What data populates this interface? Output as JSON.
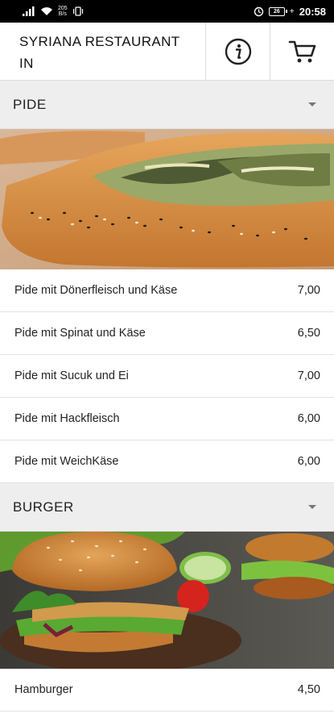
{
  "status_bar": {
    "network_top": "205",
    "network_bottom": "B/s",
    "battery_level": "26",
    "time": "20:58"
  },
  "header": {
    "title": "SYRIANA RESTAURANT IN",
    "info_icon": "info-icon",
    "cart_icon": "cart-icon"
  },
  "categories": [
    {
      "title": "PIDE",
      "image": "pide-photo",
      "items": [
        {
          "name": "Pide mit Dönerfleisch und Käse",
          "price": "7,00"
        },
        {
          "name": "Pide mit Spinat und Käse",
          "price": "6,50"
        },
        {
          "name": "Pide mit Sucuk und Ei",
          "price": "7,00"
        },
        {
          "name": "Pide mit Hackfleisch",
          "price": "6,00"
        },
        {
          "name": "Pide mit WeichKäse",
          "price": "6,00"
        }
      ]
    },
    {
      "title": "BURGER",
      "image": "burger-photo",
      "items": [
        {
          "name": "Hamburger",
          "price": "4,50"
        }
      ]
    }
  ],
  "colors": {
    "status_bar_bg": "#000000",
    "category_bg": "#eeeeee",
    "divider": "#e2e2e2"
  }
}
